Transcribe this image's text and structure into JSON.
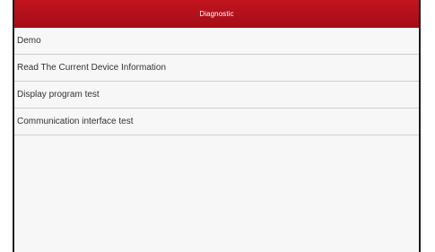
{
  "header": {
    "title": "Diagnostic"
  },
  "menu": {
    "items": [
      {
        "label": "Demo"
      },
      {
        "label": "Read The Current Device Information"
      },
      {
        "label": "Display program test"
      },
      {
        "label": "Communication interface test"
      }
    ]
  },
  "colors": {
    "titlebar": "#b3111a",
    "background": "#f7f7f7",
    "divider": "#cfcfcf",
    "text": "#333333"
  }
}
